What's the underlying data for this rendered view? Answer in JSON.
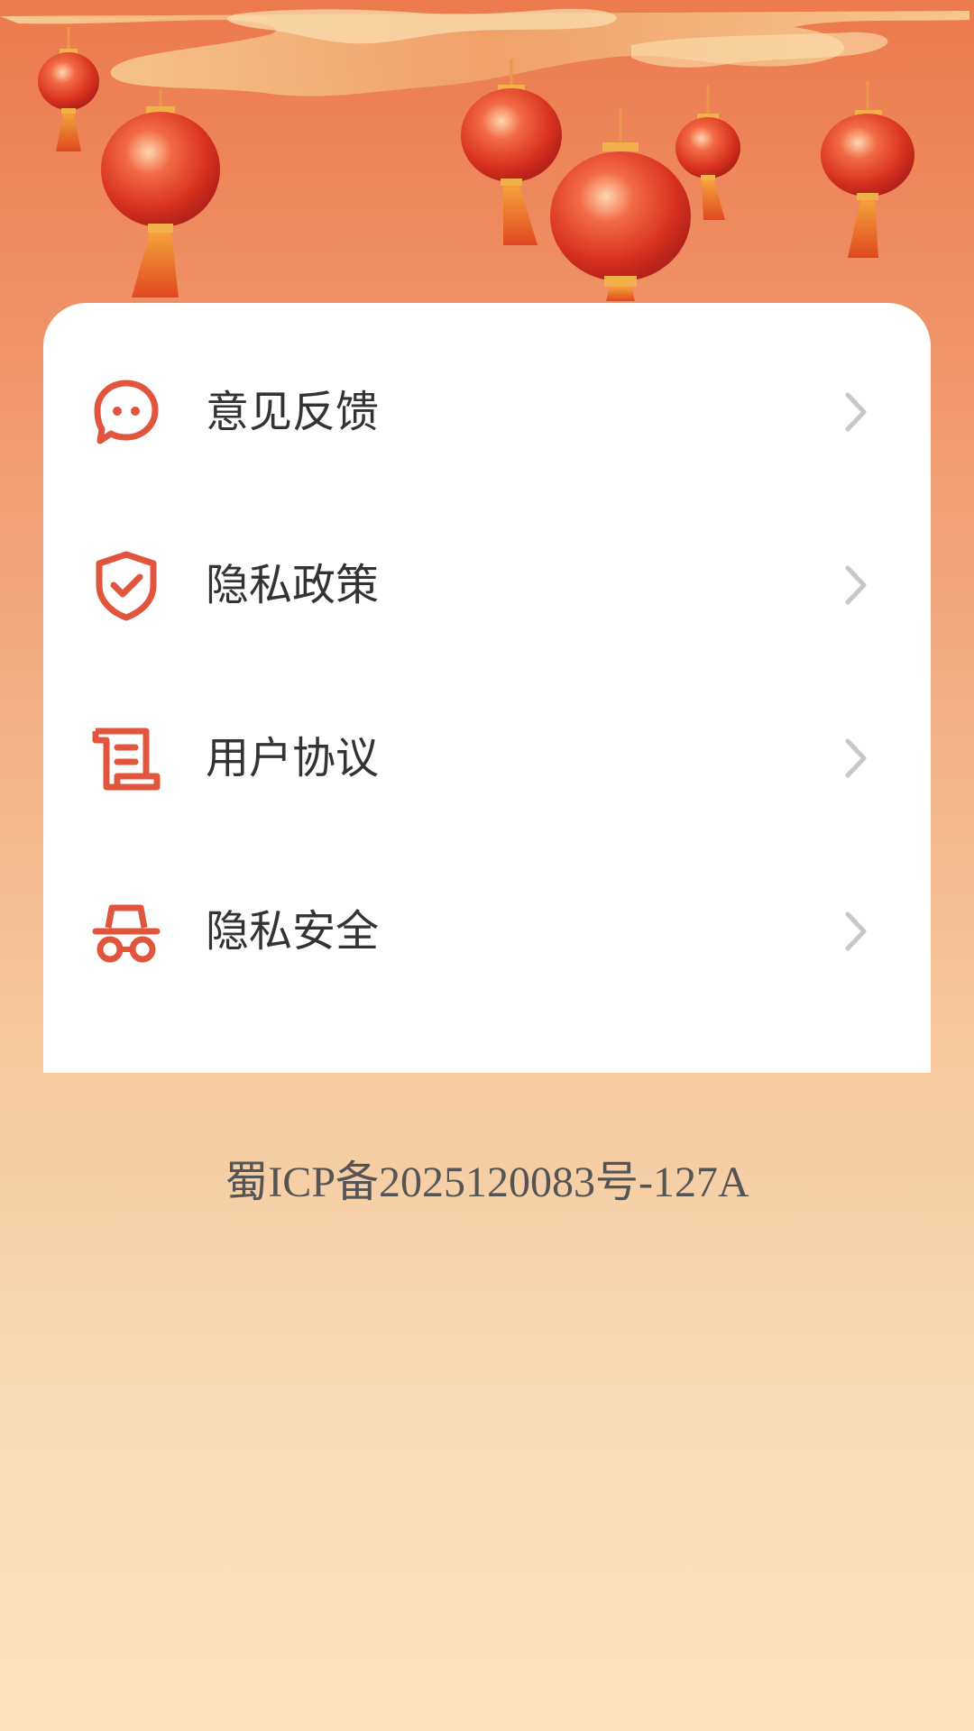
{
  "colors": {
    "accent": "#e0553c",
    "chevron": "#c8c8c8",
    "label": "#333333",
    "footer_text": "#555555",
    "card_background": "#ffffff"
  },
  "header": {
    "decoration": "chinese-lanterns-and-clouds"
  },
  "menu": {
    "items": [
      {
        "icon": "chat-bubble-icon",
        "label": "意见反馈"
      },
      {
        "icon": "shield-check-icon",
        "label": "隐私政策"
      },
      {
        "icon": "scroll-document-icon",
        "label": "用户协议"
      },
      {
        "icon": "incognito-icon",
        "label": "隐私安全"
      }
    ]
  },
  "footer": {
    "icp": "蜀ICP备2025120083号-127A"
  }
}
